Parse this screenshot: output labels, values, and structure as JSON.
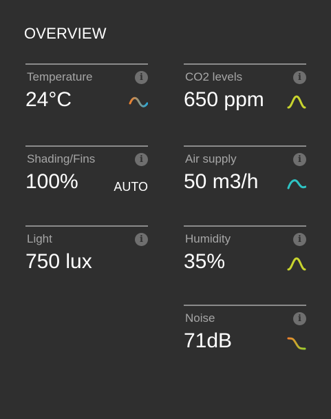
{
  "header": {
    "title": "OVERVIEW"
  },
  "metrics": {
    "temperature": {
      "label": "Temperature",
      "value": "24°C"
    },
    "co2": {
      "label": "CO2 levels",
      "value": "650 ppm"
    },
    "shading": {
      "label": "Shading/Fins",
      "value": "100%",
      "mode": "AUTO"
    },
    "air": {
      "label": "Air supply",
      "value": "50 m3/h"
    },
    "light": {
      "label": "Light",
      "value": "750 lux"
    },
    "humidity": {
      "label": "Humidity",
      "value": "35%"
    },
    "noise": {
      "label": "Noise",
      "value": "71dB"
    }
  },
  "info_glyph": "i",
  "icons": {
    "temperature": "trend-wave-orange-to-blue-icon",
    "co2": "trend-peak-yellow-green-icon",
    "air": "trend-wave-teal-icon",
    "humidity": "trend-peak-yellow-green-icon",
    "noise": "trend-step-orange-to-green-icon"
  },
  "colors": {
    "background": "#2f2f2f",
    "divider": "#8c8c8c",
    "label": "#a6a6a6",
    "info_icon": "#6f6f6f",
    "orange": "#f0822d",
    "blue": "#29a8d8",
    "teal": "#2ec4c4",
    "yellow_green": "#c8d42e",
    "green": "#9bd12e"
  }
}
